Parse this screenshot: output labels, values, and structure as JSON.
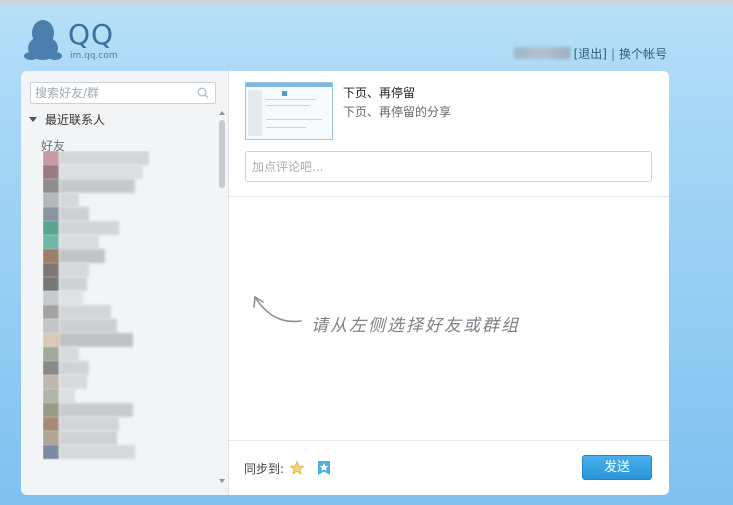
{
  "brand": {
    "logo_text": "QQ",
    "url_text": "im.qq.com"
  },
  "account": {
    "logout_label": "[退出]",
    "separator": "|",
    "switch_label": "换个帐号"
  },
  "sidebar": {
    "search_placeholder": "搜索好友/群",
    "section_label": "最近联系人",
    "group_label": "好友"
  },
  "share": {
    "title": "下页、再停留",
    "description": "下页、再停留的分享"
  },
  "comment": {
    "placeholder": "加点评论吧..."
  },
  "hint": {
    "text": "请从左侧选择好友或群组"
  },
  "footer": {
    "sync_label": "同步到:",
    "sync_targets": [
      "star-icon",
      "qzone-icon"
    ],
    "send_label": "发送"
  },
  "colors": {
    "accent": "#2a95d9",
    "page_bg": "#94cdf3"
  }
}
